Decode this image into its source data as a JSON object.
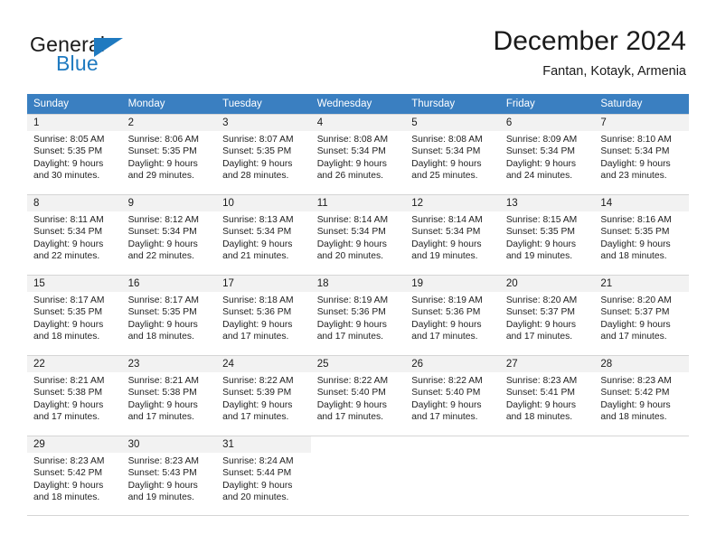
{
  "brand": {
    "name_part1": "General",
    "name_part2": "Blue",
    "flag_icon": "triangle-flag-icon",
    "accent_color": "#1f7ac0"
  },
  "header": {
    "month_title": "December 2024",
    "location": "Fantan, Kotayk, Armenia"
  },
  "calendar": {
    "header_bg": "#3a7fc1",
    "daynum_bg": "#f2f2f2",
    "weekday_headers": [
      "Sunday",
      "Monday",
      "Tuesday",
      "Wednesday",
      "Thursday",
      "Friday",
      "Saturday"
    ],
    "weeks": [
      [
        {
          "day": "1",
          "sunrise": "Sunrise: 8:05 AM",
          "sunset": "Sunset: 5:35 PM",
          "daylight_l1": "Daylight: 9 hours",
          "daylight_l2": "and 30 minutes."
        },
        {
          "day": "2",
          "sunrise": "Sunrise: 8:06 AM",
          "sunset": "Sunset: 5:35 PM",
          "daylight_l1": "Daylight: 9 hours",
          "daylight_l2": "and 29 minutes."
        },
        {
          "day": "3",
          "sunrise": "Sunrise: 8:07 AM",
          "sunset": "Sunset: 5:35 PM",
          "daylight_l1": "Daylight: 9 hours",
          "daylight_l2": "and 28 minutes."
        },
        {
          "day": "4",
          "sunrise": "Sunrise: 8:08 AM",
          "sunset": "Sunset: 5:34 PM",
          "daylight_l1": "Daylight: 9 hours",
          "daylight_l2": "and 26 minutes."
        },
        {
          "day": "5",
          "sunrise": "Sunrise: 8:08 AM",
          "sunset": "Sunset: 5:34 PM",
          "daylight_l1": "Daylight: 9 hours",
          "daylight_l2": "and 25 minutes."
        },
        {
          "day": "6",
          "sunrise": "Sunrise: 8:09 AM",
          "sunset": "Sunset: 5:34 PM",
          "daylight_l1": "Daylight: 9 hours",
          "daylight_l2": "and 24 minutes."
        },
        {
          "day": "7",
          "sunrise": "Sunrise: 8:10 AM",
          "sunset": "Sunset: 5:34 PM",
          "daylight_l1": "Daylight: 9 hours",
          "daylight_l2": "and 23 minutes."
        }
      ],
      [
        {
          "day": "8",
          "sunrise": "Sunrise: 8:11 AM",
          "sunset": "Sunset: 5:34 PM",
          "daylight_l1": "Daylight: 9 hours",
          "daylight_l2": "and 22 minutes."
        },
        {
          "day": "9",
          "sunrise": "Sunrise: 8:12 AM",
          "sunset": "Sunset: 5:34 PM",
          "daylight_l1": "Daylight: 9 hours",
          "daylight_l2": "and 22 minutes."
        },
        {
          "day": "10",
          "sunrise": "Sunrise: 8:13 AM",
          "sunset": "Sunset: 5:34 PM",
          "daylight_l1": "Daylight: 9 hours",
          "daylight_l2": "and 21 minutes."
        },
        {
          "day": "11",
          "sunrise": "Sunrise: 8:14 AM",
          "sunset": "Sunset: 5:34 PM",
          "daylight_l1": "Daylight: 9 hours",
          "daylight_l2": "and 20 minutes."
        },
        {
          "day": "12",
          "sunrise": "Sunrise: 8:14 AM",
          "sunset": "Sunset: 5:34 PM",
          "daylight_l1": "Daylight: 9 hours",
          "daylight_l2": "and 19 minutes."
        },
        {
          "day": "13",
          "sunrise": "Sunrise: 8:15 AM",
          "sunset": "Sunset: 5:35 PM",
          "daylight_l1": "Daylight: 9 hours",
          "daylight_l2": "and 19 minutes."
        },
        {
          "day": "14",
          "sunrise": "Sunrise: 8:16 AM",
          "sunset": "Sunset: 5:35 PM",
          "daylight_l1": "Daylight: 9 hours",
          "daylight_l2": "and 18 minutes."
        }
      ],
      [
        {
          "day": "15",
          "sunrise": "Sunrise: 8:17 AM",
          "sunset": "Sunset: 5:35 PM",
          "daylight_l1": "Daylight: 9 hours",
          "daylight_l2": "and 18 minutes."
        },
        {
          "day": "16",
          "sunrise": "Sunrise: 8:17 AM",
          "sunset": "Sunset: 5:35 PM",
          "daylight_l1": "Daylight: 9 hours",
          "daylight_l2": "and 18 minutes."
        },
        {
          "day": "17",
          "sunrise": "Sunrise: 8:18 AM",
          "sunset": "Sunset: 5:36 PM",
          "daylight_l1": "Daylight: 9 hours",
          "daylight_l2": "and 17 minutes."
        },
        {
          "day": "18",
          "sunrise": "Sunrise: 8:19 AM",
          "sunset": "Sunset: 5:36 PM",
          "daylight_l1": "Daylight: 9 hours",
          "daylight_l2": "and 17 minutes."
        },
        {
          "day": "19",
          "sunrise": "Sunrise: 8:19 AM",
          "sunset": "Sunset: 5:36 PM",
          "daylight_l1": "Daylight: 9 hours",
          "daylight_l2": "and 17 minutes."
        },
        {
          "day": "20",
          "sunrise": "Sunrise: 8:20 AM",
          "sunset": "Sunset: 5:37 PM",
          "daylight_l1": "Daylight: 9 hours",
          "daylight_l2": "and 17 minutes."
        },
        {
          "day": "21",
          "sunrise": "Sunrise: 8:20 AM",
          "sunset": "Sunset: 5:37 PM",
          "daylight_l1": "Daylight: 9 hours",
          "daylight_l2": "and 17 minutes."
        }
      ],
      [
        {
          "day": "22",
          "sunrise": "Sunrise: 8:21 AM",
          "sunset": "Sunset: 5:38 PM",
          "daylight_l1": "Daylight: 9 hours",
          "daylight_l2": "and 17 minutes."
        },
        {
          "day": "23",
          "sunrise": "Sunrise: 8:21 AM",
          "sunset": "Sunset: 5:38 PM",
          "daylight_l1": "Daylight: 9 hours",
          "daylight_l2": "and 17 minutes."
        },
        {
          "day": "24",
          "sunrise": "Sunrise: 8:22 AM",
          "sunset": "Sunset: 5:39 PM",
          "daylight_l1": "Daylight: 9 hours",
          "daylight_l2": "and 17 minutes."
        },
        {
          "day": "25",
          "sunrise": "Sunrise: 8:22 AM",
          "sunset": "Sunset: 5:40 PM",
          "daylight_l1": "Daylight: 9 hours",
          "daylight_l2": "and 17 minutes."
        },
        {
          "day": "26",
          "sunrise": "Sunrise: 8:22 AM",
          "sunset": "Sunset: 5:40 PM",
          "daylight_l1": "Daylight: 9 hours",
          "daylight_l2": "and 17 minutes."
        },
        {
          "day": "27",
          "sunrise": "Sunrise: 8:23 AM",
          "sunset": "Sunset: 5:41 PM",
          "daylight_l1": "Daylight: 9 hours",
          "daylight_l2": "and 18 minutes."
        },
        {
          "day": "28",
          "sunrise": "Sunrise: 8:23 AM",
          "sunset": "Sunset: 5:42 PM",
          "daylight_l1": "Daylight: 9 hours",
          "daylight_l2": "and 18 minutes."
        }
      ],
      [
        {
          "day": "29",
          "sunrise": "Sunrise: 8:23 AM",
          "sunset": "Sunset: 5:42 PM",
          "daylight_l1": "Daylight: 9 hours",
          "daylight_l2": "and 18 minutes."
        },
        {
          "day": "30",
          "sunrise": "Sunrise: 8:23 AM",
          "sunset": "Sunset: 5:43 PM",
          "daylight_l1": "Daylight: 9 hours",
          "daylight_l2": "and 19 minutes."
        },
        {
          "day": "31",
          "sunrise": "Sunrise: 8:24 AM",
          "sunset": "Sunset: 5:44 PM",
          "daylight_l1": "Daylight: 9 hours",
          "daylight_l2": "and 20 minutes."
        },
        {
          "day": "",
          "sunrise": "",
          "sunset": "",
          "daylight_l1": "",
          "daylight_l2": ""
        },
        {
          "day": "",
          "sunrise": "",
          "sunset": "",
          "daylight_l1": "",
          "daylight_l2": ""
        },
        {
          "day": "",
          "sunrise": "",
          "sunset": "",
          "daylight_l1": "",
          "daylight_l2": ""
        },
        {
          "day": "",
          "sunrise": "",
          "sunset": "",
          "daylight_l1": "",
          "daylight_l2": ""
        }
      ]
    ]
  }
}
